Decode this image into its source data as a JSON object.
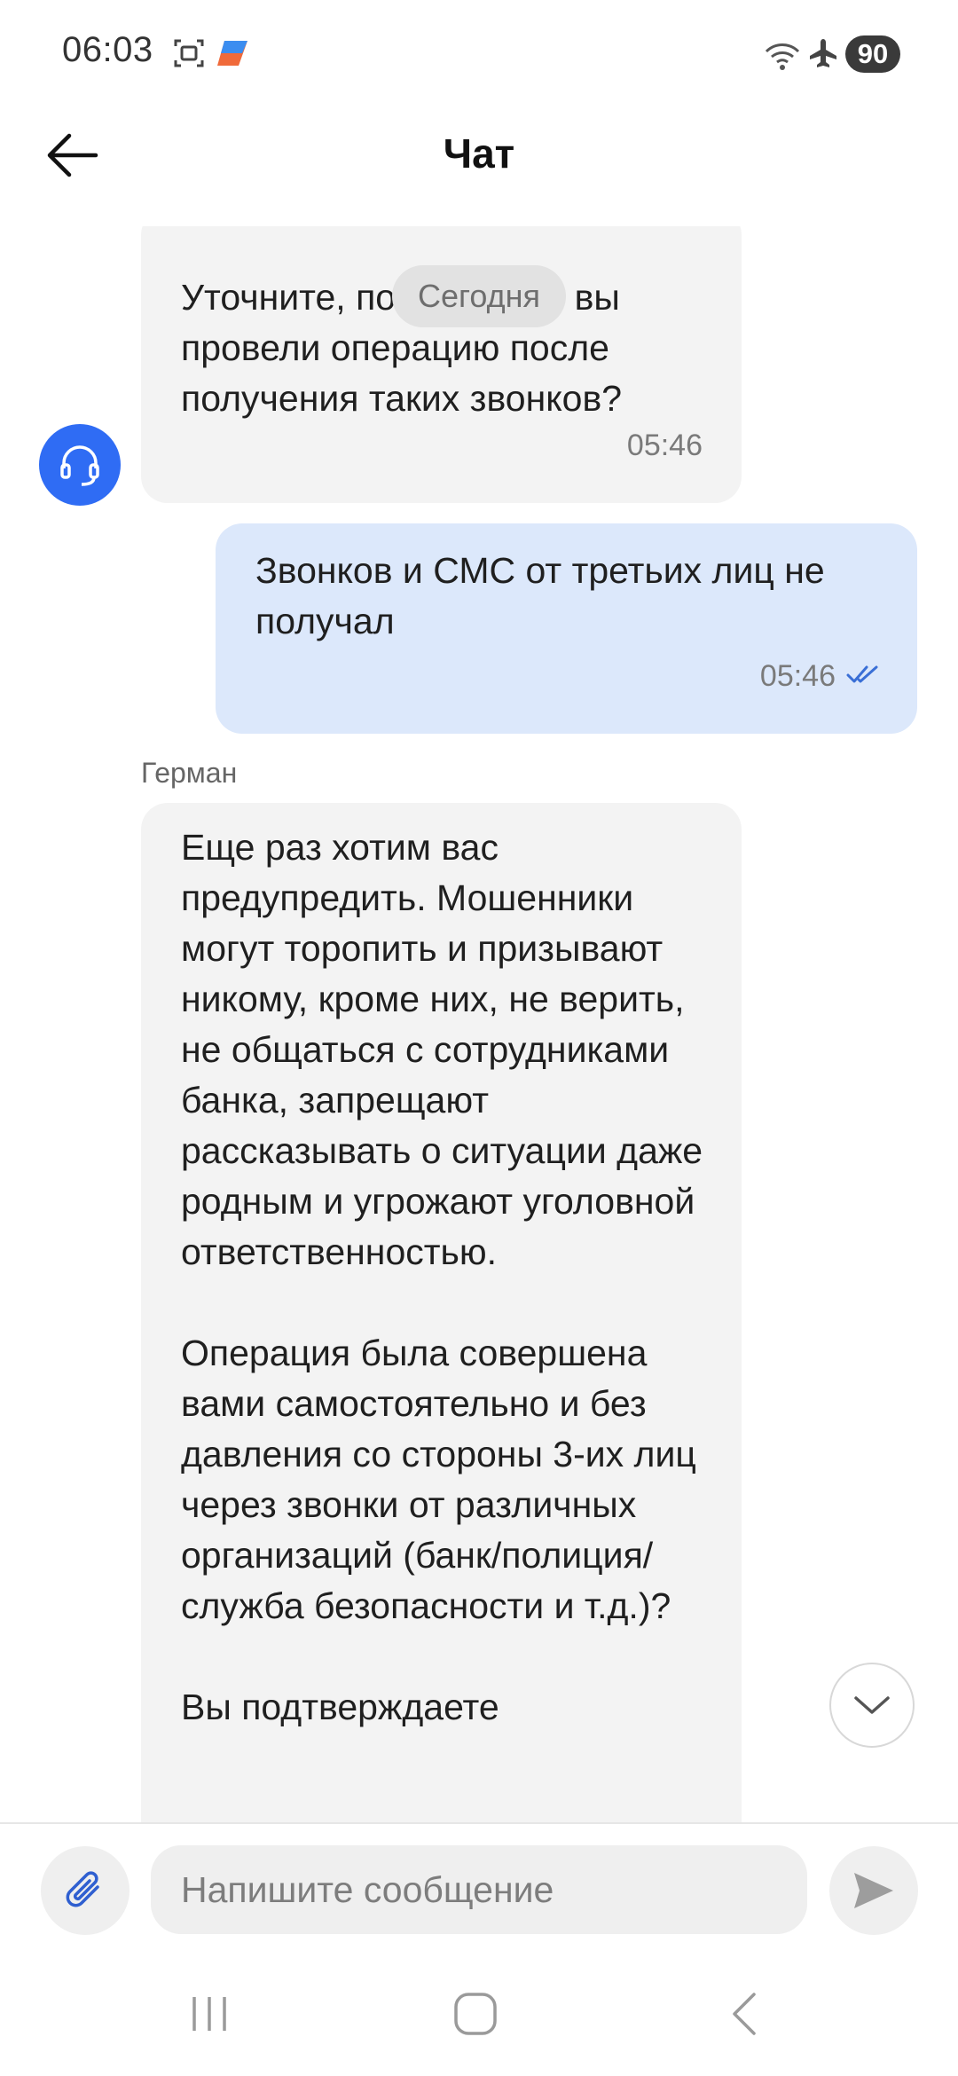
{
  "status_bar": {
    "time": "06:03",
    "battery": "90",
    "icons": [
      "screenshot-icon",
      "app-notification-icon",
      "wifi-icon",
      "airplane-mode-icon",
      "battery-icon"
    ]
  },
  "header": {
    "title": "Чат",
    "back_icon": "arrow-left-icon"
  },
  "chat": {
    "date_separator": "Сегодня",
    "messages": [
      {
        "direction": "incoming",
        "text": "Уточните, пожалуйста, вы провели операцию после получения таких звонков?",
        "time": "05:46"
      },
      {
        "direction": "outgoing",
        "text": "Звонков и СМС от третьих лиц не получал",
        "time": "05:46",
        "status_icon": "double-check-icon"
      },
      {
        "direction": "incoming",
        "sender": "Герман",
        "text": "Еще раз хотим вас предупредить. Мошенники могут торопить и призывают никому, кроме них, не верить, не общаться с сотрудниками банка, запрещают рассказывать о ситуации даже родным и угрожают уголовной ответственностью.\n\nОперация была совершена вами самостоятельно и без давления со стороны 3-их лиц через звонки от различных организаций (банк/полиция/служба безопасности и т.д.)?\n\nВы подтверждаете"
      }
    ]
  },
  "composer": {
    "placeholder": "Напишите сообщение",
    "value": ""
  },
  "colors": {
    "accent": "#2f6cf4",
    "incoming_bubble": "#f3f3f3",
    "outgoing_bubble": "#dce8fb"
  }
}
